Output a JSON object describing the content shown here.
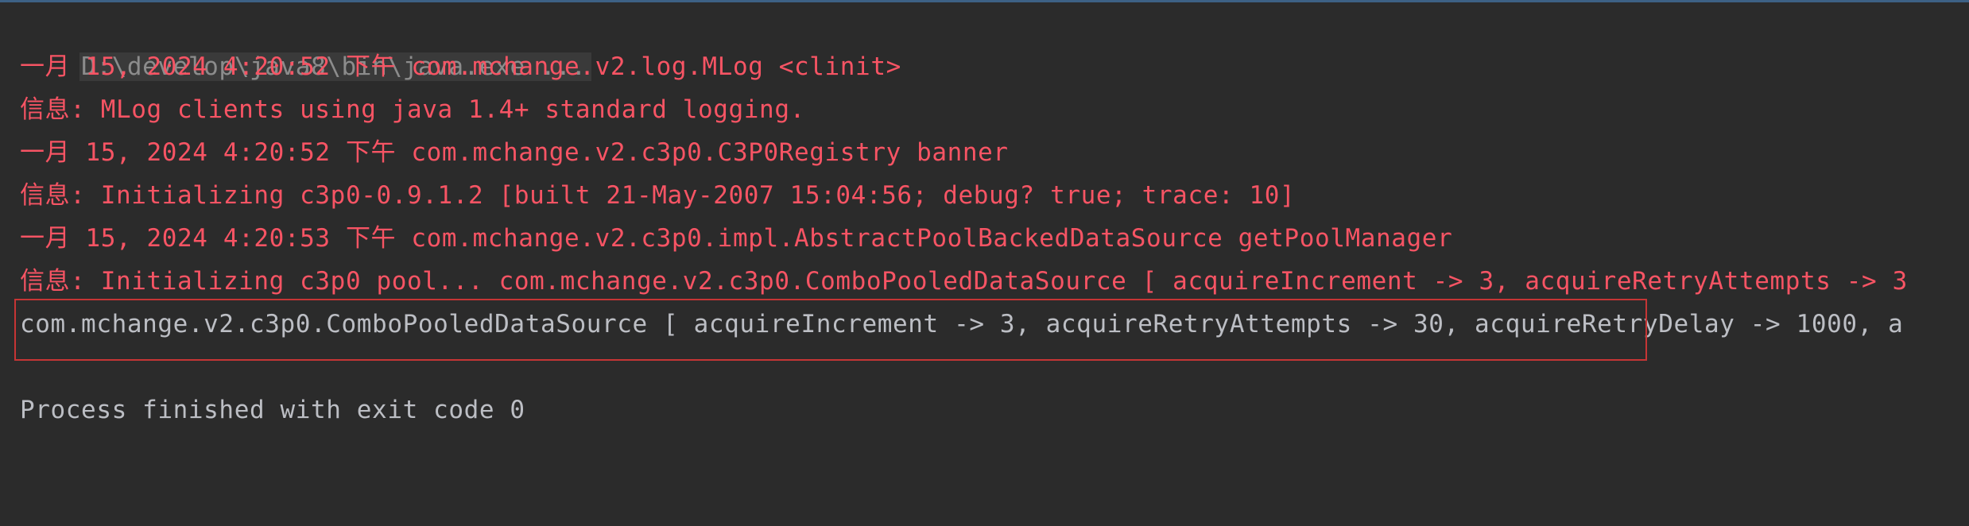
{
  "console": {
    "command": "D:\\develop\\java8\\bin\\java.exe ...",
    "lines": [
      "一月 15, 2024 4:20:52 下午 com.mchange.v2.log.MLog <clinit>",
      "信息: MLog clients using java 1.4+ standard logging.",
      "一月 15, 2024 4:20:52 下午 com.mchange.v2.c3p0.C3P0Registry banner",
      "信息: Initializing c3p0-0.9.1.2 [built 21-May-2007 15:04:56; debug? true; trace: 10]",
      "一月 15, 2024 4:20:53 下午 com.mchange.v2.c3p0.impl.AbstractPoolBackedDataSource getPoolManager",
      "信息: Initializing c3p0 pool... com.mchange.v2.c3p0.ComboPooledDataSource [ acquireIncrement -> 3, acquireRetryAttempts -> 3"
    ],
    "stdout_line": "com.mchange.v2.c3p0.ComboPooledDataSource [ acquireIncrement -> 3, acquireRetryAttempts -> 30, acquireRetryDelay -> 1000, a",
    "exit_message": "Process finished with exit code 0"
  },
  "colors": {
    "background": "#2b2b2b",
    "stderr_text": "#f75464",
    "stdout_text": "#bcbec4",
    "highlight_border": "#c63535"
  }
}
